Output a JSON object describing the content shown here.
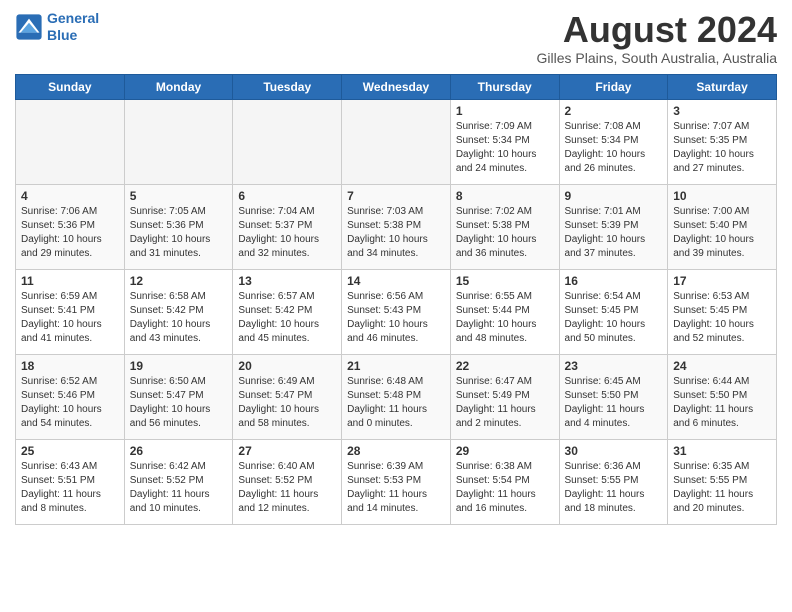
{
  "header": {
    "logo_line1": "General",
    "logo_line2": "Blue",
    "main_title": "August 2024",
    "subtitle": "Gilles Plains, South Australia, Australia"
  },
  "days_of_week": [
    "Sunday",
    "Monday",
    "Tuesday",
    "Wednesday",
    "Thursday",
    "Friday",
    "Saturday"
  ],
  "weeks": [
    [
      {
        "day": "",
        "info": ""
      },
      {
        "day": "",
        "info": ""
      },
      {
        "day": "",
        "info": ""
      },
      {
        "day": "",
        "info": ""
      },
      {
        "day": "1",
        "info": "Sunrise: 7:09 AM\nSunset: 5:34 PM\nDaylight: 10 hours\nand 24 minutes."
      },
      {
        "day": "2",
        "info": "Sunrise: 7:08 AM\nSunset: 5:34 PM\nDaylight: 10 hours\nand 26 minutes."
      },
      {
        "day": "3",
        "info": "Sunrise: 7:07 AM\nSunset: 5:35 PM\nDaylight: 10 hours\nand 27 minutes."
      }
    ],
    [
      {
        "day": "4",
        "info": "Sunrise: 7:06 AM\nSunset: 5:36 PM\nDaylight: 10 hours\nand 29 minutes."
      },
      {
        "day": "5",
        "info": "Sunrise: 7:05 AM\nSunset: 5:36 PM\nDaylight: 10 hours\nand 31 minutes."
      },
      {
        "day": "6",
        "info": "Sunrise: 7:04 AM\nSunset: 5:37 PM\nDaylight: 10 hours\nand 32 minutes."
      },
      {
        "day": "7",
        "info": "Sunrise: 7:03 AM\nSunset: 5:38 PM\nDaylight: 10 hours\nand 34 minutes."
      },
      {
        "day": "8",
        "info": "Sunrise: 7:02 AM\nSunset: 5:38 PM\nDaylight: 10 hours\nand 36 minutes."
      },
      {
        "day": "9",
        "info": "Sunrise: 7:01 AM\nSunset: 5:39 PM\nDaylight: 10 hours\nand 37 minutes."
      },
      {
        "day": "10",
        "info": "Sunrise: 7:00 AM\nSunset: 5:40 PM\nDaylight: 10 hours\nand 39 minutes."
      }
    ],
    [
      {
        "day": "11",
        "info": "Sunrise: 6:59 AM\nSunset: 5:41 PM\nDaylight: 10 hours\nand 41 minutes."
      },
      {
        "day": "12",
        "info": "Sunrise: 6:58 AM\nSunset: 5:42 PM\nDaylight: 10 hours\nand 43 minutes."
      },
      {
        "day": "13",
        "info": "Sunrise: 6:57 AM\nSunset: 5:42 PM\nDaylight: 10 hours\nand 45 minutes."
      },
      {
        "day": "14",
        "info": "Sunrise: 6:56 AM\nSunset: 5:43 PM\nDaylight: 10 hours\nand 46 minutes."
      },
      {
        "day": "15",
        "info": "Sunrise: 6:55 AM\nSunset: 5:44 PM\nDaylight: 10 hours\nand 48 minutes."
      },
      {
        "day": "16",
        "info": "Sunrise: 6:54 AM\nSunset: 5:45 PM\nDaylight: 10 hours\nand 50 minutes."
      },
      {
        "day": "17",
        "info": "Sunrise: 6:53 AM\nSunset: 5:45 PM\nDaylight: 10 hours\nand 52 minutes."
      }
    ],
    [
      {
        "day": "18",
        "info": "Sunrise: 6:52 AM\nSunset: 5:46 PM\nDaylight: 10 hours\nand 54 minutes."
      },
      {
        "day": "19",
        "info": "Sunrise: 6:50 AM\nSunset: 5:47 PM\nDaylight: 10 hours\nand 56 minutes."
      },
      {
        "day": "20",
        "info": "Sunrise: 6:49 AM\nSunset: 5:47 PM\nDaylight: 10 hours\nand 58 minutes."
      },
      {
        "day": "21",
        "info": "Sunrise: 6:48 AM\nSunset: 5:48 PM\nDaylight: 11 hours\nand 0 minutes."
      },
      {
        "day": "22",
        "info": "Sunrise: 6:47 AM\nSunset: 5:49 PM\nDaylight: 11 hours\nand 2 minutes."
      },
      {
        "day": "23",
        "info": "Sunrise: 6:45 AM\nSunset: 5:50 PM\nDaylight: 11 hours\nand 4 minutes."
      },
      {
        "day": "24",
        "info": "Sunrise: 6:44 AM\nSunset: 5:50 PM\nDaylight: 11 hours\nand 6 minutes."
      }
    ],
    [
      {
        "day": "25",
        "info": "Sunrise: 6:43 AM\nSunset: 5:51 PM\nDaylight: 11 hours\nand 8 minutes."
      },
      {
        "day": "26",
        "info": "Sunrise: 6:42 AM\nSunset: 5:52 PM\nDaylight: 11 hours\nand 10 minutes."
      },
      {
        "day": "27",
        "info": "Sunrise: 6:40 AM\nSunset: 5:52 PM\nDaylight: 11 hours\nand 12 minutes."
      },
      {
        "day": "28",
        "info": "Sunrise: 6:39 AM\nSunset: 5:53 PM\nDaylight: 11 hours\nand 14 minutes."
      },
      {
        "day": "29",
        "info": "Sunrise: 6:38 AM\nSunset: 5:54 PM\nDaylight: 11 hours\nand 16 minutes."
      },
      {
        "day": "30",
        "info": "Sunrise: 6:36 AM\nSunset: 5:55 PM\nDaylight: 11 hours\nand 18 minutes."
      },
      {
        "day": "31",
        "info": "Sunrise: 6:35 AM\nSunset: 5:55 PM\nDaylight: 11 hours\nand 20 minutes."
      }
    ]
  ]
}
